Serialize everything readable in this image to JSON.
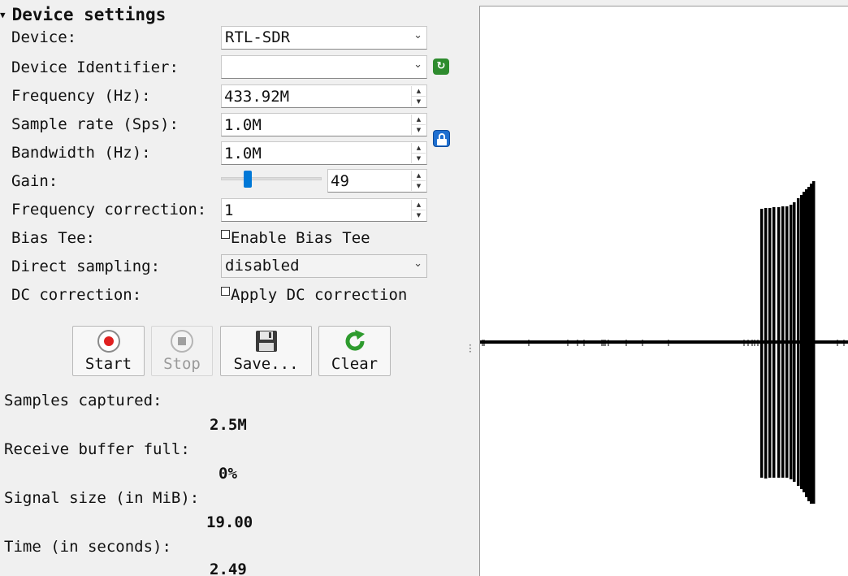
{
  "section": {
    "title": "Device settings"
  },
  "labels": {
    "device": "Device:",
    "device_identifier": "Device Identifier:",
    "frequency": "Frequency (Hz):",
    "sample_rate": "Sample rate (Sps):",
    "bandwidth": "Bandwidth (Hz):",
    "gain": "Gain:",
    "freq_correction": "Frequency correction:",
    "bias_tee": "Bias Tee:",
    "direct_sampling": "Direct sampling:",
    "dc_correction": "DC correction:"
  },
  "fields": {
    "device": "RTL-SDR",
    "device_identifier": "",
    "frequency": "433.92M",
    "sample_rate": "1.0M",
    "bandwidth": "1.0M",
    "gain": "49",
    "gain_slider_fraction": 0.2,
    "freq_correction": "1",
    "bias_tee_label": "Enable Bias Tee",
    "bias_tee_checked": false,
    "direct_sampling": "disabled",
    "dc_correction_label": "Apply DC correction",
    "dc_correction_checked": false
  },
  "icons": {
    "refresh": "refresh-icon",
    "lock": "lock-icon",
    "combo_arrow": "chevron-down-icon",
    "spin_up": "arrow-up-icon",
    "spin_down": "arrow-down-icon"
  },
  "toolbar": {
    "start": "Start",
    "stop": "Stop",
    "save": "Save...",
    "clear": "Clear"
  },
  "stats": {
    "samples_captured_label": "Samples captured:",
    "samples_captured": "2.5M",
    "buffer_full_label": "Receive buffer full:",
    "buffer_full": "0%",
    "signal_size_label": "Signal size (in MiB):",
    "signal_size": "19.00",
    "time_label": "Time (in seconds):",
    "time": "2.49"
  },
  "colors": {
    "start_red": "#e02020",
    "refresh_green": "#2e8b2e",
    "lock_blue": "#1e6fd0",
    "slider_blue": "#0078d7",
    "signal": "#000000"
  }
}
